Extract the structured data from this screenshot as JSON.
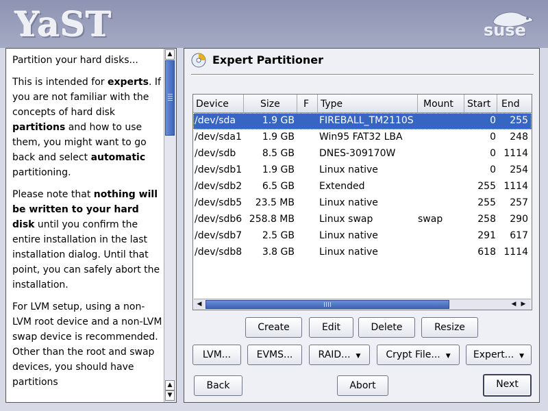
{
  "banner": {
    "logo_text": "YaST",
    "suse_text": "suse"
  },
  "help": {
    "paragraphs": [
      [
        {
          "t": "Partition your hard disks...",
          "b": false
        }
      ],
      [
        {
          "t": "This is intended for ",
          "b": false
        },
        {
          "t": "experts",
          "b": true
        },
        {
          "t": ". If you are not familiar with the concepts of hard disk ",
          "b": false
        },
        {
          "t": "partitions",
          "b": true
        },
        {
          "t": " and how to use them, you might want to go back and select ",
          "b": false
        },
        {
          "t": "automatic",
          "b": true
        },
        {
          "t": " partitioning.",
          "b": false
        }
      ],
      [
        {
          "t": "Please note that ",
          "b": false
        },
        {
          "t": "nothing will be written to your hard disk",
          "b": true
        },
        {
          "t": " until you confirm the entire installation in the last installation dialog. Until that point, you can safely abort the installation.",
          "b": false
        }
      ],
      [
        {
          "t": "For LVM setup, using a non-LVM root device and a non-LVM swap device is recommended. Other than the root and swap devices, you should have partitions",
          "b": false
        }
      ]
    ]
  },
  "partitioner": {
    "title": "Expert Partitioner",
    "columns": [
      "Device",
      "Size",
      "F",
      "Type",
      "Mount",
      "Start",
      "End"
    ],
    "rows": [
      {
        "device": "/dev/sda",
        "size": "1.9 GB",
        "f": "",
        "type": "FIREBALL_TM2110S",
        "mount": "",
        "start": "0",
        "end": "255",
        "selected": true
      },
      {
        "device": "/dev/sda1",
        "size": "1.9 GB",
        "f": "",
        "type": "Win95 FAT32 LBA",
        "mount": "",
        "start": "0",
        "end": "248",
        "selected": false
      },
      {
        "device": "/dev/sdb",
        "size": "8.5 GB",
        "f": "",
        "type": "DNES-309170W",
        "mount": "",
        "start": "0",
        "end": "1114",
        "selected": false
      },
      {
        "device": "/dev/sdb1",
        "size": "1.9 GB",
        "f": "",
        "type": "Linux native",
        "mount": "",
        "start": "0",
        "end": "254",
        "selected": false
      },
      {
        "device": "/dev/sdb2",
        "size": "6.5 GB",
        "f": "",
        "type": "Extended",
        "mount": "",
        "start": "255",
        "end": "1114",
        "selected": false
      },
      {
        "device": "/dev/sdb5",
        "size": "23.5 MB",
        "f": "",
        "type": "Linux native",
        "mount": "",
        "start": "255",
        "end": "257",
        "selected": false
      },
      {
        "device": "/dev/sdb6",
        "size": "258.8 MB",
        "f": "",
        "type": "Linux swap",
        "mount": "swap",
        "start": "258",
        "end": "290",
        "selected": false
      },
      {
        "device": "/dev/sdb7",
        "size": "2.5 GB",
        "f": "",
        "type": "Linux native",
        "mount": "",
        "start": "291",
        "end": "617",
        "selected": false
      },
      {
        "device": "/dev/sdb8",
        "size": "3.8 GB",
        "f": "",
        "type": "Linux native",
        "mount": "",
        "start": "618",
        "end": "1114",
        "selected": false
      }
    ],
    "buttons": {
      "create": "Create",
      "edit": "Edit",
      "delete": "Delete",
      "resize": "Resize",
      "lvm": "LVM...",
      "evms": "EVMS...",
      "raid": "RAID...",
      "crypt": "Crypt File...",
      "expert": "Expert..."
    }
  },
  "footer": {
    "back": "Back",
    "abort": "Abort",
    "next": "Next"
  },
  "colors": {
    "selection": "#3766c2",
    "banner": "#9a9fbc",
    "background": "#d7d9e6"
  }
}
